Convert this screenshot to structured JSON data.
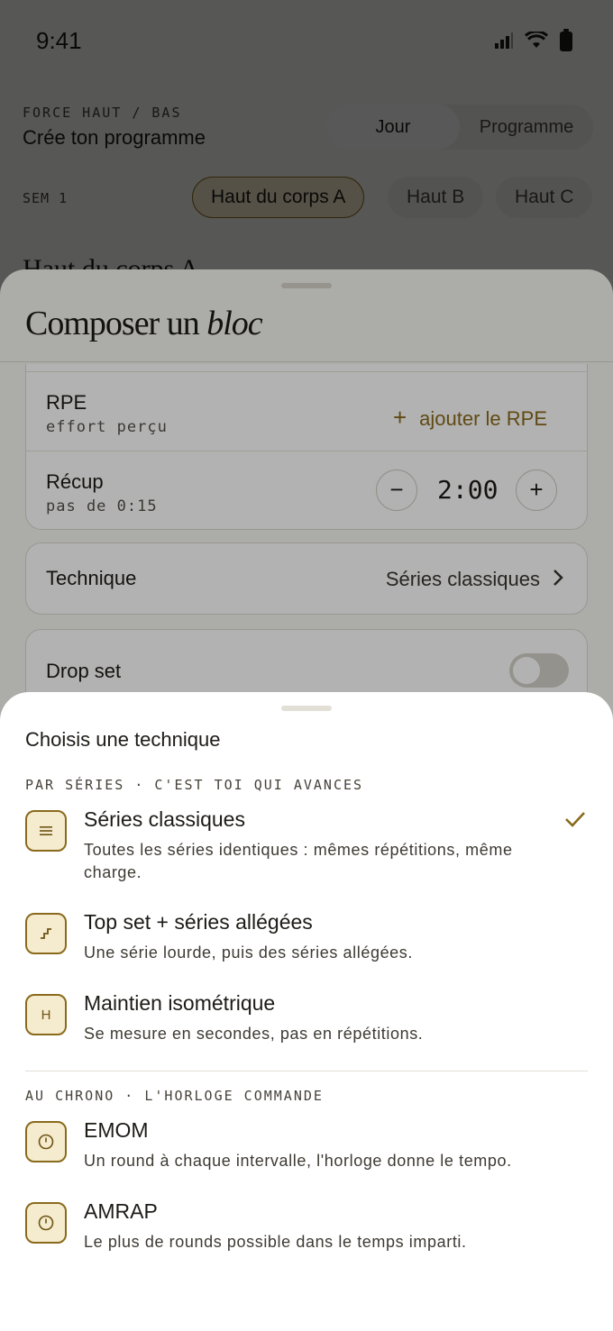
{
  "status_bar": {
    "time": "9:41"
  },
  "header": {
    "kicker": "FORCE HAUT / BAS",
    "title": "Crée ton programme",
    "tabs": [
      "Jour",
      "Programme"
    ]
  },
  "week": {
    "label": "SEM 1",
    "days": [
      "Haut du corps A",
      "Haut B",
      "Haut C"
    ]
  },
  "day_title": "Haut du corps A",
  "compose_sheet": {
    "title_plain": "Composer un",
    "title_italic": "bloc",
    "rpe": {
      "label": "RPE",
      "sub": "effort perçu",
      "action": "ajouter le RPE"
    },
    "rest": {
      "label": "Récup",
      "sub": "pas de 0:15",
      "value": "2:00",
      "minus": "−",
      "plus": "+"
    },
    "technique": {
      "label": "Technique",
      "value": "Séries classiques"
    },
    "drop_set": {
      "label": "Drop set",
      "enabled": false
    }
  },
  "technique_sheet": {
    "title": "Choisis une technique",
    "sections": [
      {
        "heading": "PAR SÉRIES · C'EST TOI QUI AVANCES",
        "items": [
          {
            "name": "Séries classiques",
            "desc": "Toutes les séries identiques : mêmes répétitions, même charge.",
            "icon": "lines-icon",
            "selected": true
          },
          {
            "name": "Top set + séries allégées",
            "desc": "Une série lourde, puis des séries allégées.",
            "icon": "steps-icon",
            "selected": false
          },
          {
            "name": "Maintien isométrique",
            "desc": "Se mesure en secondes, pas en répétitions.",
            "icon": "hold-icon",
            "glyph": "H",
            "selected": false
          }
        ]
      },
      {
        "heading": "AU CHRONO · L'HORLOGE COMMANDE",
        "items": [
          {
            "name": "EMOM",
            "desc": "Un round à chaque intervalle, l'horloge donne le tempo.",
            "icon": "timer-icon",
            "selected": false
          },
          {
            "name": "AMRAP",
            "desc": "Le plus de rounds possible dans le temps imparti.",
            "icon": "timer-icon",
            "selected": false
          }
        ]
      }
    ]
  },
  "colors": {
    "accent": "#8a6a1c",
    "accent_bg": "#f5ebce",
    "scrim": "#000000"
  }
}
